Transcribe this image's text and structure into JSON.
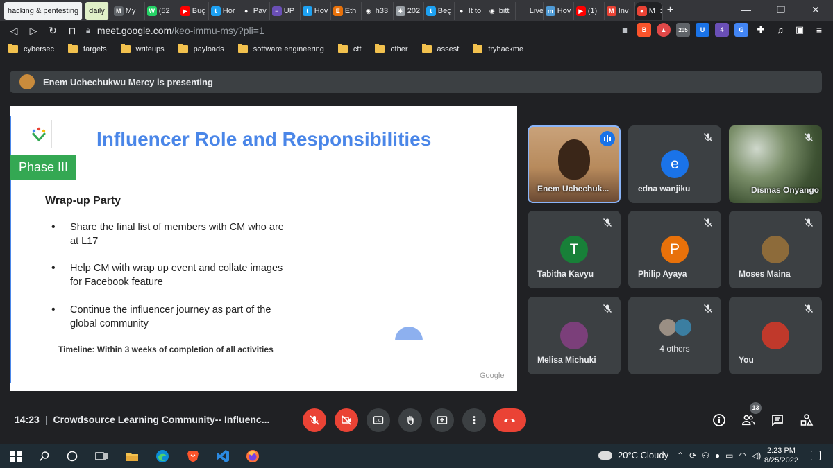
{
  "browser": {
    "tabs": [
      {
        "label": "hacking & pentesting",
        "kind": "group",
        "color": "#f1f3f4"
      },
      {
        "label": "daily",
        "kind": "group",
        "color": "#e0f0c8"
      },
      {
        "label": "My",
        "fav": "M",
        "favcolor": "#5f6368"
      },
      {
        "label": "(52",
        "fav": "W",
        "favcolor": "#25d366"
      },
      {
        "label": "Buç",
        "fav": "▶",
        "favcolor": "#ff0000"
      },
      {
        "label": "Hor",
        "fav": "t",
        "favcolor": "#1da1f2"
      },
      {
        "label": "Pav",
        "fav": "●",
        "favcolor": "#35363a"
      },
      {
        "label": "UP",
        "fav": "≡",
        "favcolor": "#6a4fb6"
      },
      {
        "label": "Hov",
        "fav": "t",
        "favcolor": "#1da1f2"
      },
      {
        "label": "Eth",
        "fav": "E",
        "favcolor": "#e8710a"
      },
      {
        "label": "h33",
        "fav": "◉",
        "favcolor": "#35363a"
      },
      {
        "label": "202",
        "fav": "✱",
        "favcolor": "#9aa0a6"
      },
      {
        "label": "Beç",
        "fav": "t",
        "favcolor": "#1da1f2"
      },
      {
        "label": "It to",
        "fav": "●",
        "favcolor": "#35363a"
      },
      {
        "label": "bitt",
        "fav": "◉",
        "favcolor": "#35363a"
      },
      {
        "label": "Live",
        "fav": "",
        "favcolor": "#35363a"
      },
      {
        "label": "Hov",
        "fav": "m",
        "favcolor": "#4f9bd6"
      },
      {
        "label": "(1)",
        "fav": "▶",
        "favcolor": "#ff0000"
      },
      {
        "label": "Inv",
        "fav": "M",
        "favcolor": "#ea4335"
      },
      {
        "label": "M",
        "fav": "●",
        "favcolor": "#ea4335",
        "active": true
      }
    ],
    "close_tab": "✕",
    "new_tab": "+",
    "window": {
      "minimize": "—",
      "restore": "❐",
      "close": "✕"
    },
    "url_host": "meet.google.com",
    "url_path": "/keo-immu-msy?pli=1",
    "ext_badge": "205",
    "ext_counter": "4",
    "bookmarks": [
      "cybersec",
      "targets",
      "writeups",
      "payloads",
      "software engineering",
      "ctf",
      "other",
      "assest",
      "tryhackme"
    ]
  },
  "meet": {
    "banner": "Enem Uchechukwu Mercy is presenting",
    "slide": {
      "title": "Influencer Role and Responsibilities",
      "phase": "Phase III",
      "heading": "Wrap-up Party",
      "bullets": [
        "Share the final list of members with CM who are at L17",
        "Help CM with wrap up event and collate images for Facebook feature",
        "Continue the influencer journey as part of the global community"
      ],
      "timeline": "Timeline: Within 3 weeks of completion of all activities",
      "footer": "Google"
    },
    "participants": [
      {
        "name": "Enem Uchechuk...",
        "type": "video",
        "speaking": true
      },
      {
        "name": "edna wanjiku",
        "initial": "e",
        "color": "#1a73e8",
        "muted": true
      },
      {
        "name": "Dismas Onyango",
        "type": "photo-full",
        "muted": true
      },
      {
        "name": "Tabitha Kavyu",
        "initial": "T",
        "color": "#188038",
        "muted": true
      },
      {
        "name": "Philip Ayaya",
        "initial": "P",
        "color": "#e8710a",
        "muted": true
      },
      {
        "name": "Moses Maina",
        "type": "avatar",
        "color": "#8d6b3a",
        "muted": true
      },
      {
        "name": "Melisa Michuki",
        "type": "avatar",
        "color": "#7b3f7a",
        "muted": true
      },
      {
        "name": "4 others",
        "type": "others",
        "muted": true
      },
      {
        "name": "You",
        "type": "avatar",
        "color": "#c0392b",
        "muted": true
      }
    ],
    "footer": {
      "time": "14:23",
      "meeting_title": "Crowdsource Learning Community-- Influenc...",
      "participants_count": "13"
    }
  },
  "taskbar": {
    "weather": "20°C  Cloudy",
    "time": "2:23 PM",
    "date": "8/25/2022"
  }
}
